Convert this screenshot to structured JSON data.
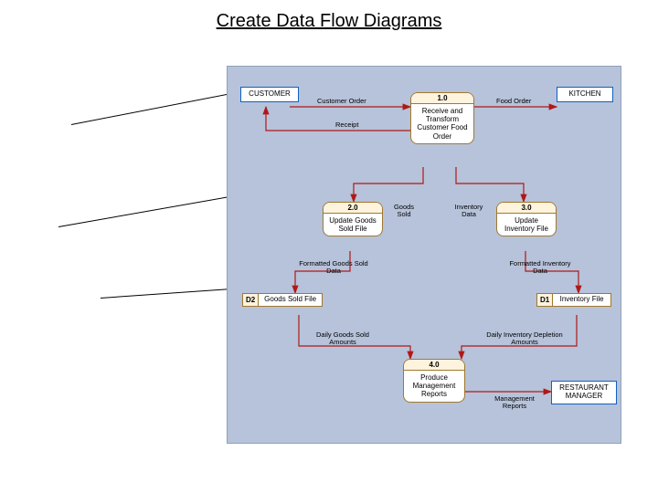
{
  "title": "Create Data Flow  Diagrams",
  "entities": {
    "customer": "CUSTOMER",
    "kitchen": "KITCHEN",
    "manager": "RESTAURANT MANAGER"
  },
  "processes": {
    "p1": {
      "id": "1.0",
      "label": "Receive and Transform Customer Food Order"
    },
    "p2": {
      "id": "2.0",
      "label": "Update Goods Sold File"
    },
    "p3": {
      "id": "3.0",
      "label": "Update Inventory File"
    },
    "p4": {
      "id": "4.0",
      "label": "Produce Management Reports"
    }
  },
  "stores": {
    "d1": {
      "id": "D1",
      "label": "Inventory File"
    },
    "d2": {
      "id": "D2",
      "label": "Goods Sold File"
    }
  },
  "flows": {
    "customer_order": "Customer Order",
    "receipt": "Receipt",
    "food_order": "Food Order",
    "goods_sold": "Goods Sold",
    "inventory_data": "Inventory Data",
    "fmt_goods": "Formatted Goods Sold Data",
    "fmt_inv": "Formatted Inventory Data",
    "daily_goods": "Daily Goods Sold Amounts",
    "daily_inv": "Daily Inventory Depletion Amounts",
    "mgmt_reports": "Management Reports"
  }
}
